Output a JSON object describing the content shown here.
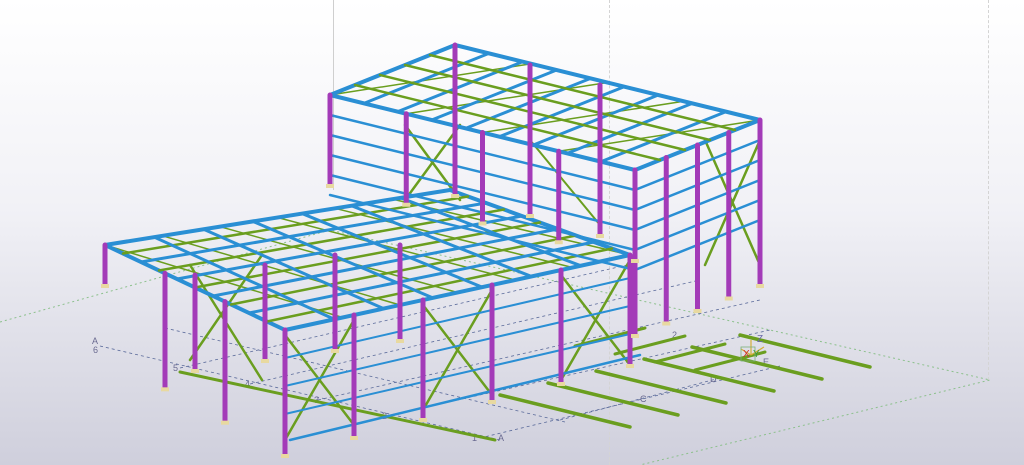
{
  "app": {
    "view": "3D model view"
  },
  "grid_labels": {
    "row_letters": [
      "A",
      "B",
      "C",
      "D",
      "E"
    ],
    "row_letter_secondary": "6",
    "column_numbers": [
      "5",
      "4",
      "3",
      "2",
      "1"
    ],
    "tail_label": "2"
  },
  "axis_gizmo": {
    "x": "X",
    "y": "Y",
    "z": "Z"
  },
  "colors": {
    "beam_blue": "#2a8fd4",
    "column_purple": "#a33bb8",
    "brace_green": "#6a9e1f",
    "grid_line": "#5a6a9a",
    "view_frame": "#cfcfcf",
    "ground_dots": "#8cc08c",
    "background_top": "#ffffff",
    "background_bottom": "#cfcfdc"
  }
}
